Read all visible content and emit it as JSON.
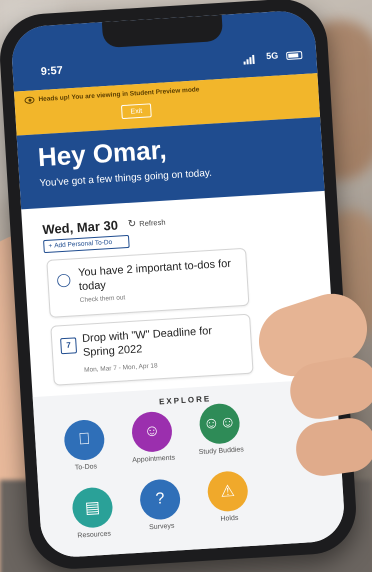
{
  "status": {
    "time": "9:57",
    "network": "5G"
  },
  "banner": {
    "text": "Heads up! You are viewing in Student Preview mode",
    "exit_label": "Exit"
  },
  "greeting": {
    "title": "Hey Omar,",
    "subtitle": "You've got a few things going on today."
  },
  "agenda": {
    "date": "Wed, Mar 30",
    "refresh_label": "Refresh",
    "add_todo_label": "Add Personal To-Do"
  },
  "cards": [
    {
      "title": "You have 2 important to-dos for today",
      "subtitle": "Check them out"
    },
    {
      "title": "Drop with \"W\" Deadline for Spring 2022",
      "subtitle": "Mon, Mar 7 - Mon, Apr 18"
    }
  ],
  "explore": {
    "title": "EXPLORE",
    "tiles": [
      {
        "label": "To-Dos",
        "color": "#2f6fb8",
        "icon": "apple-icon"
      },
      {
        "label": "Appointments",
        "color": "#9b2fae",
        "icon": "person-icon"
      },
      {
        "label": "Study Buddies",
        "color": "#2e8b57",
        "icon": "people-icon"
      },
      {
        "label": "Resources",
        "color": "#2aa198",
        "icon": "book-icon"
      },
      {
        "label": "Surveys",
        "color": "#2f6fb8",
        "icon": "chat-icon"
      },
      {
        "label": "Holds",
        "color": "#f0a92b",
        "icon": "warning-icon"
      }
    ]
  }
}
